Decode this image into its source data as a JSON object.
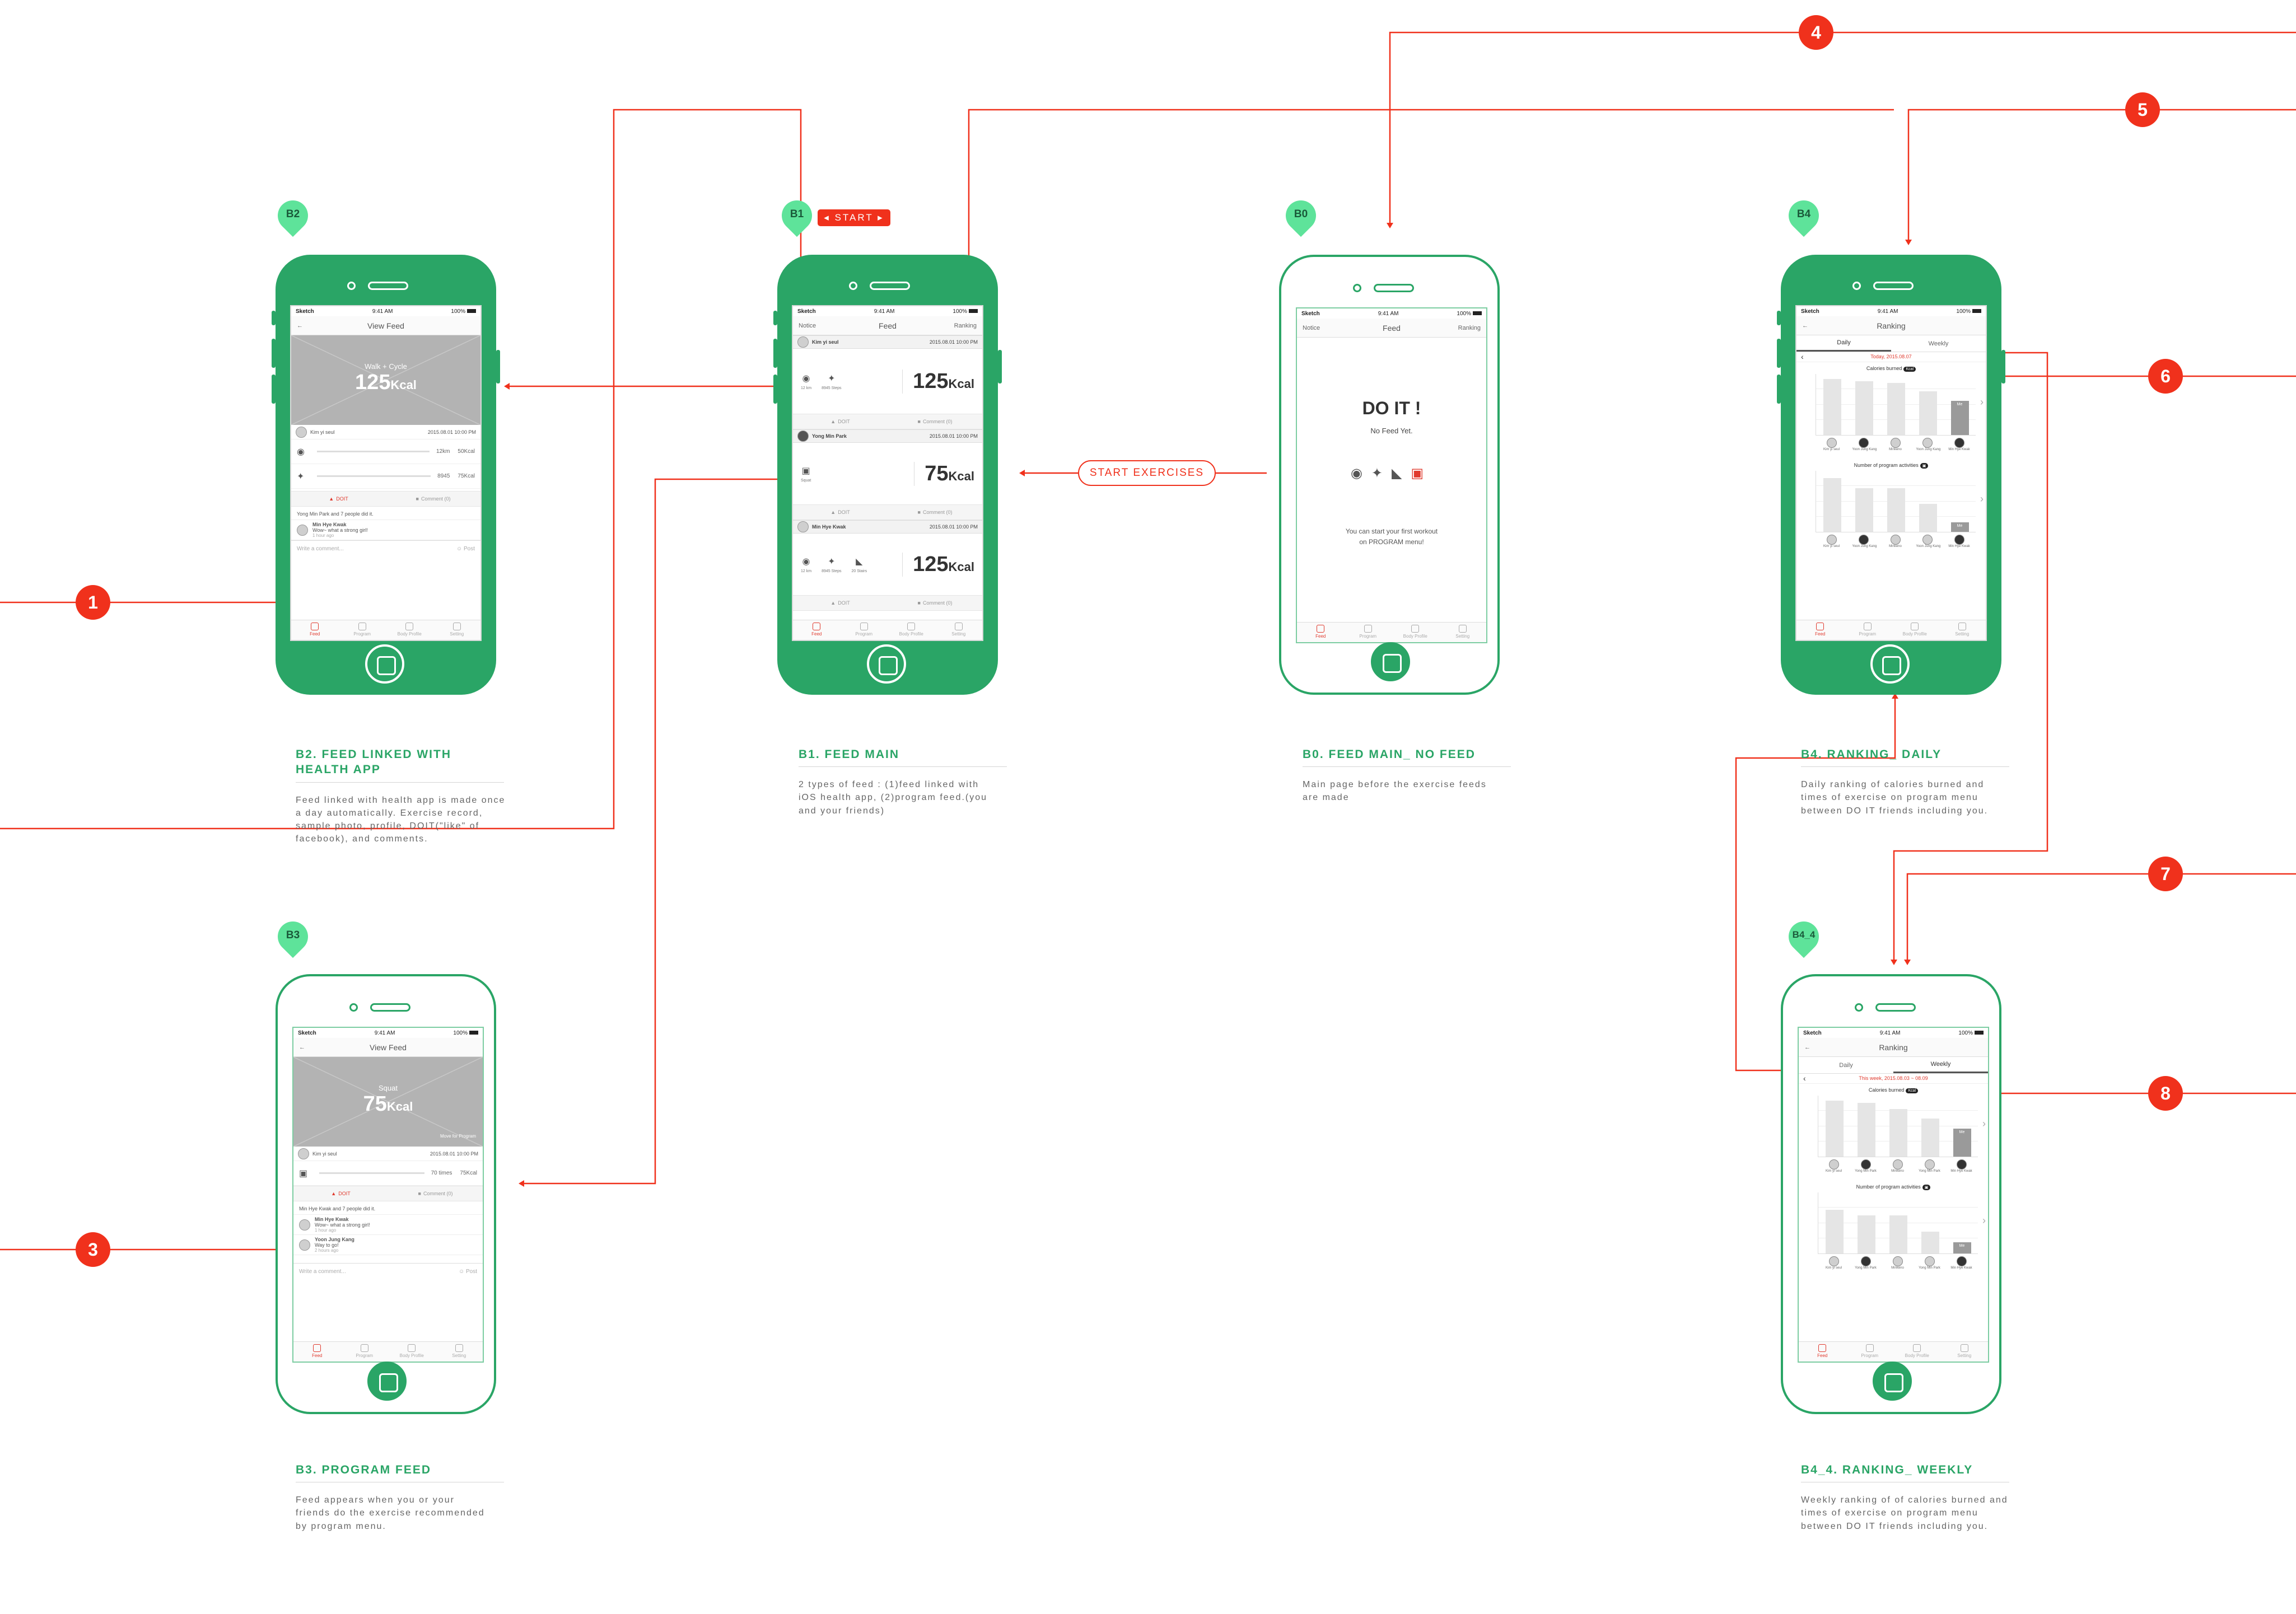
{
  "status_bar": {
    "carrier": "Sketch",
    "time": "9:41 AM",
    "battery": "100%"
  },
  "tabbar": [
    "Feed",
    "Program",
    "Body Profile",
    "Setting"
  ],
  "badges": {
    "start": "START",
    "start_exercises": "START EXERCISES"
  },
  "pins": [
    "B2",
    "B1",
    "B0",
    "B4",
    "B3",
    "B4_4"
  ],
  "steps": [
    "1",
    "2",
    "3",
    "4",
    "5",
    "6",
    "7",
    "8"
  ],
  "colors": {
    "brand_green": "#2aa566",
    "pin_green": "#5ee39a",
    "accent_red": "#f0311c"
  },
  "b2": {
    "title": "View Feed",
    "photo_sub": "Walk + Cycle",
    "photo_value": "125",
    "photo_unit": "Kcal",
    "user": "Kim yi seul",
    "date": "2015.08.01 10:00 PM",
    "row1_dist": "12km",
    "row1_kcal": "50Kcal",
    "row2_steps": "8945",
    "row2_kcal": "75Kcal",
    "like": "DOIT",
    "comment": "Comment (0)",
    "liked_by": "Yong Min Park and 7 people did it.",
    "comment_user": "Min Hye Kwak",
    "comment_text": "Wow~ what a strong girl!",
    "comment_time": "1 hour ago",
    "write_placeholder": "Write a comment...",
    "post": "Post"
  },
  "b1": {
    "left": "Notice",
    "title": "Feed",
    "right": "Ranking",
    "cards": [
      {
        "user": "Kim yi seul",
        "date": "2015.08.01 10:00 PM",
        "labels": [
          "12 km",
          "8945 Steps"
        ],
        "value": "125",
        "unit": "Kcal"
      },
      {
        "user": "Yong Min Park",
        "date": "2015.08.01 10:00 PM",
        "labels": [
          "Squat"
        ],
        "value": "75",
        "unit": "Kcal"
      },
      {
        "user": "Min Hye Kwak",
        "date": "2015.08.01 10:00 PM",
        "labels": [
          "12 km",
          "8945 Steps",
          "20 Stairs"
        ],
        "value": "125",
        "unit": "Kcal"
      }
    ],
    "like": "DOIT",
    "comment": "Comment (0)"
  },
  "b0": {
    "left": "Notice",
    "title": "Feed",
    "right": "Ranking",
    "heading": "DO IT !",
    "sub": "No Feed Yet.",
    "hint1": "You can start your first workout",
    "hint2": "on PROGRAM menu!"
  },
  "b4": {
    "title": "Ranking",
    "tab_daily": "Daily",
    "tab_weekly": "Weekly",
    "date": "Today, 2015.08.07",
    "chart1_title": "Calories burned",
    "chart1_unit": "Kcal",
    "chart2_title": "Number of program activities",
    "me_label": "Me",
    "names": [
      "Kim yi seul",
      "Yoon Jung Kang",
      "Minkeno",
      "Yoon Jung Kang",
      "Min Hye Kwak"
    ]
  },
  "b3": {
    "title": "View Feed",
    "photo_sub": "Squat",
    "photo_value": "75",
    "photo_unit": "Kcal",
    "photo_note": "Move for Program",
    "user": "Kim yi seul",
    "date": "2015.08.01 10:00 PM",
    "row1_times": "70 times",
    "row1_kcal": "75Kcal",
    "like": "DOIT",
    "comment": "Comment (0)",
    "liked_by": "Min Hye Kwak and 7 people did it.",
    "comment1_user": "Min Hye Kwak",
    "comment1_text": "Wow~ what a strong girl!",
    "comment1_time": "1 hour ago",
    "comment2_user": "Yoon Jung Kang",
    "comment2_text": "Way to go!",
    "comment2_time": "2 hours ago",
    "write_placeholder": "Write a comment...",
    "post": "Post"
  },
  "b44": {
    "title": "Ranking",
    "tab_daily": "Daily",
    "tab_weekly": "Weekly",
    "date": "This week, 2015.08.03 ~ 08.09",
    "chart1_title": "Calories burned",
    "chart1_unit": "Kcal",
    "chart2_title": "Number of program activities",
    "me_label": "Me",
    "names": [
      "Kim yi seul",
      "Yong Min Park",
      "Minkeno",
      "Yong Min Park",
      "Min Hye Kwak"
    ]
  },
  "captions": {
    "b2_title": "B2. FEED LINKED WITH HEALTH APP",
    "b2_desc": "Feed linked with health app is made once a day automatically. Exercise record, sample photo, profile, DOIT(\"like\" of facebook), and comments.",
    "b1_title": "B1. FEED MAIN",
    "b1_desc": "2 types of feed : (1)feed linked with iOS health app, (2)program feed.(you and your friends)",
    "b0_title": "B0. FEED MAIN_ NO FEED",
    "b0_desc": "Main page before the exercise feeds are made",
    "b4_title": "B4. RANKING_ DAILY",
    "b4_desc": "Daily ranking of calories burned and times of exercise on program menu between DO IT friends including you.",
    "b3_title": "B3. PROGRAM FEED",
    "b3_desc": "Feed appears when you or your friends do the exercise recommended by program menu.",
    "b44_title": "B4_4. RANKING_ WEEKLY",
    "b44_desc": "Weekly ranking of of calories burned and times of exercise on program menu between DO IT friends including you."
  }
}
